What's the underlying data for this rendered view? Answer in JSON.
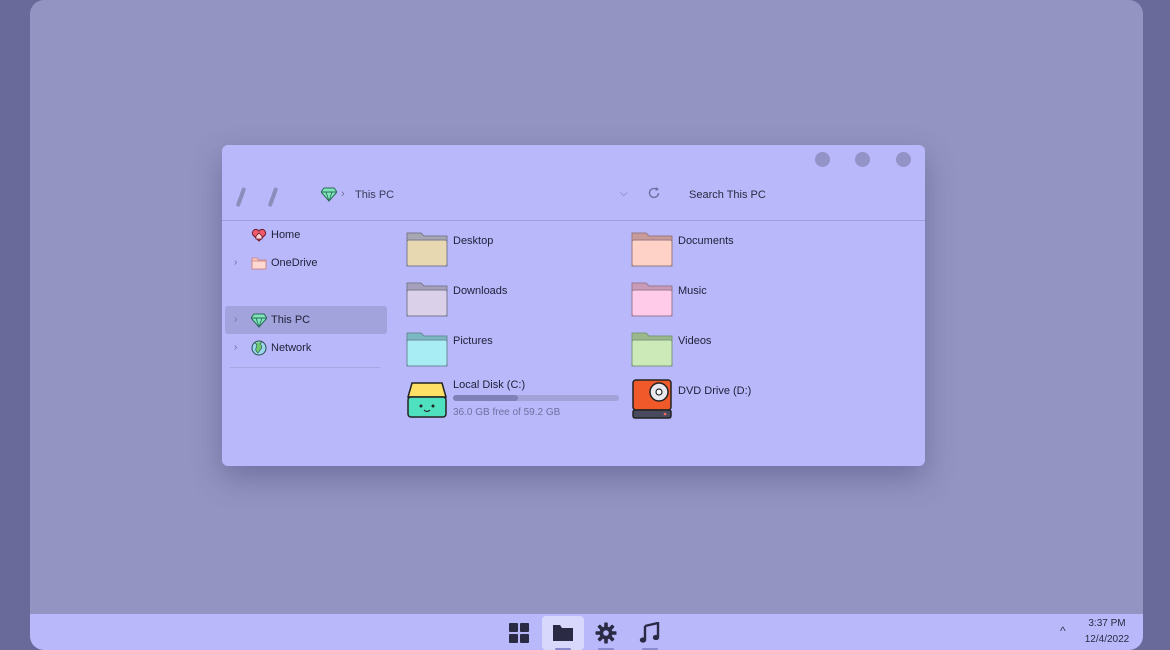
{
  "window": {
    "controls": [
      "minimize",
      "maximize",
      "close"
    ],
    "address": {
      "icon": "diamond-icon",
      "separator": "›",
      "location": "This PC"
    },
    "dropdown_glyph": "⌵",
    "search_placeholder": "Search This PC"
  },
  "sidebar": {
    "chevron": "›",
    "items": [
      {
        "label": "Home",
        "icon": "home-heart-icon"
      },
      {
        "label": "OneDrive",
        "icon": "folder-icon"
      },
      {
        "label": "This PC",
        "icon": "diamond-icon",
        "selected": true
      },
      {
        "label": "Network",
        "icon": "globe-icon"
      }
    ]
  },
  "content": {
    "folders": [
      {
        "label": "Desktop",
        "color": "#e8d8b2"
      },
      {
        "label": "Documents",
        "color": "#ffd2c8"
      },
      {
        "label": "Downloads",
        "color": "#dad0ea"
      },
      {
        "label": "Music",
        "color": "#ffcbe8"
      },
      {
        "label": "Pictures",
        "color": "#a8ecf4"
      },
      {
        "label": "Videos",
        "color": "#cceab8"
      }
    ],
    "drives": [
      {
        "label": "Local Disk (C:)",
        "free_text": "36.0 GB free of 59.2 GB",
        "used_fraction": 0.39,
        "icon": "hard-disk-icon"
      },
      {
        "label": "DVD Drive (D:)",
        "icon": "dvd-drive-icon"
      }
    ]
  },
  "taskbar": {
    "apps": [
      {
        "name": "start",
        "icon": "windows-icon"
      },
      {
        "name": "file-explorer",
        "icon": "folder-icon",
        "active": true
      },
      {
        "name": "settings",
        "icon": "gear-icon"
      },
      {
        "name": "music",
        "icon": "music-note-icon"
      }
    ],
    "tray_chevron": "^",
    "time": "3:37 PM",
    "date": "12/4/2022"
  },
  "colors": {
    "accent": "#b8b8fb",
    "desktop": "#9494c2",
    "outer": "#6a6a9a",
    "selection": "#a2a2dc"
  }
}
